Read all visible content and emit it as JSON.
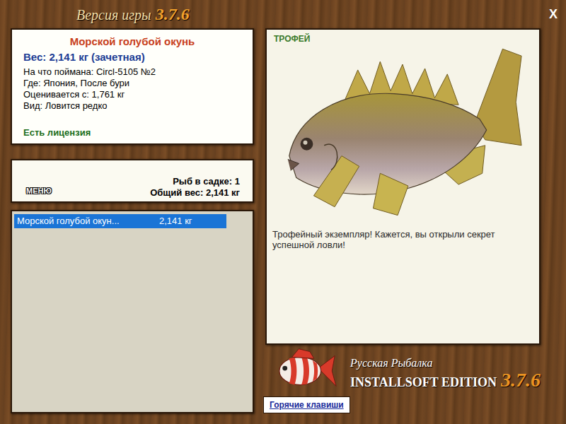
{
  "window": {
    "title": "Версия игры",
    "version": "3.7.6",
    "close": "X"
  },
  "fish_card": {
    "name": "Морской голубой окунь",
    "weight": "Вес: 2,141 кг (зачетная)",
    "details": [
      "На что поймана: Circl-5105 №2",
      "Где: Япония, После бури",
      "Оценивается с: 1,761 кг",
      "Вид: Ловится редко"
    ],
    "license": "Есть лицензия"
  },
  "cage": {
    "menu_button": "МЕНЮ",
    "count": "Рыб в садке: 1",
    "total": "Общий вес: 2,141 кг"
  },
  "catch_list": [
    {
      "name": "Морской голубой окун...",
      "weight": "2,141 кг",
      "selected": true
    }
  ],
  "trophy": {
    "badge": "ТРОФЕЙ",
    "description": "Трофейный экземпляр! Кажется, вы открыли секрет успешной ловли!"
  },
  "logo": {
    "title": "Русская Рыбалка",
    "edition": "INSTALLSOFT EDITION",
    "version": "3.7.6"
  },
  "buttons": [
    "Горячие клавиши"
  ]
}
